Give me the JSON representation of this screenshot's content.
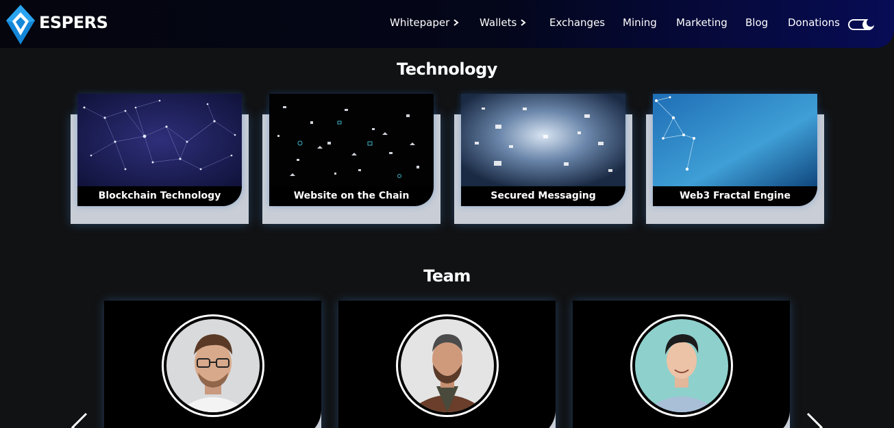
{
  "brand": {
    "name": "ESPERS",
    "logo_icon": "espers-diamond-logo-icon"
  },
  "nav": {
    "items": [
      {
        "label": "Whitepaper",
        "has_submenu": true
      },
      {
        "label": "Wallets",
        "has_submenu": true
      },
      {
        "label": "Exchanges",
        "has_submenu": false
      },
      {
        "label": "Mining",
        "has_submenu": false
      },
      {
        "label": "Marketing",
        "has_submenu": false
      },
      {
        "label": "Blog",
        "has_submenu": false
      },
      {
        "label": "Donations",
        "has_submenu": false
      }
    ],
    "theme_toggle_icon": "moon-icon"
  },
  "technology": {
    "title": "Technology",
    "cards": [
      {
        "label": "Blockchain Technology",
        "image": "network-constellation-image"
      },
      {
        "label": "Website on the Chain",
        "image": "floating-icons-image"
      },
      {
        "label": "Secured Messaging",
        "image": "message-cloud-image"
      },
      {
        "label": "Web3 Fractal Engine",
        "image": "blue-network-image"
      }
    ]
  },
  "team": {
    "title": "Team",
    "members": [
      {
        "photo": "member-glasses-portrait"
      },
      {
        "photo": "member-beard-portrait"
      },
      {
        "photo": "member-smiling-portrait"
      }
    ],
    "prev_icon": "chevron-left-icon",
    "next_icon": "chevron-right-icon"
  },
  "colors": {
    "background": "#111213",
    "header_gradient_end": "#070c55",
    "card_frame": "#c9ced6",
    "accent_blue": "#1e90e8"
  }
}
